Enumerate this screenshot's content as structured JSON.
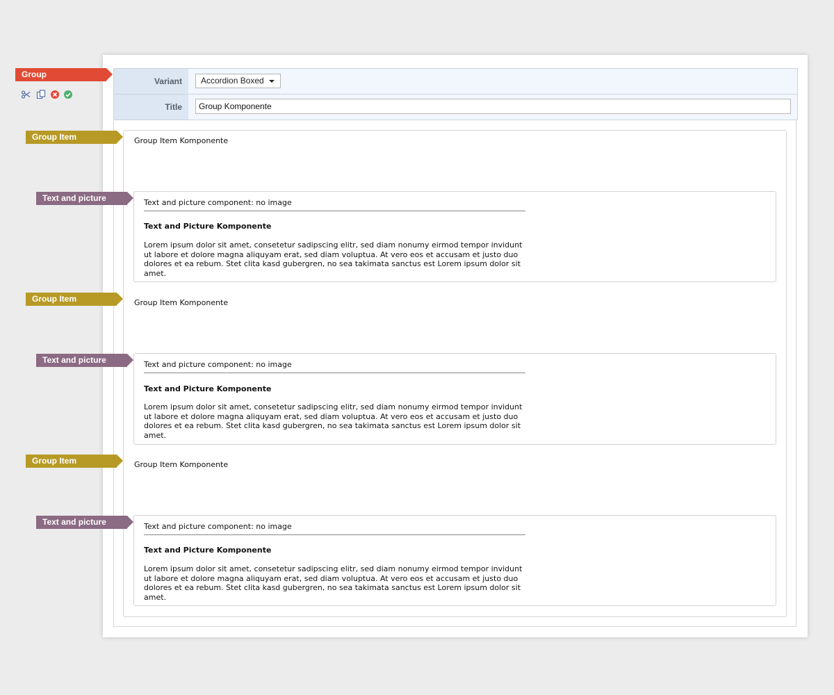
{
  "labels": {
    "group": "Group",
    "group_item": "Group Item",
    "text_and_picture": "Text and picture"
  },
  "toolbar": {
    "icons": [
      "scissors-icon",
      "copy-icon",
      "delete-icon",
      "confirm-icon"
    ],
    "colors": {
      "icon_blue": "#5574a6",
      "delete": "#e5463a",
      "confirm": "#4caf6e"
    }
  },
  "form": {
    "variant": {
      "label": "Variant",
      "value": "Accordion Boxed"
    },
    "title": {
      "label": "Title",
      "value": "Group Komponente"
    }
  },
  "group_items": [
    {
      "title": "Group Item Komponente",
      "text_picture": {
        "header": "Text and picture component: no image",
        "heading": "Text and Picture Komponente",
        "body": "Lorem ipsum dolor sit amet, consetetur sadipscing elitr, sed diam nonumy eirmod tempor invidunt ut labore et dolore magna aliquyam erat, sed diam voluptua. At vero eos et accusam et justo duo dolores et ea rebum. Stet clita kasd gubergren, no sea takimata sanctus est Lorem ipsum dolor sit amet."
      }
    },
    {
      "title": "Group Item Komponente",
      "text_picture": {
        "header": "Text and picture component: no image",
        "heading": "Text and Picture Komponente",
        "body": "Lorem ipsum dolor sit amet, consetetur sadipscing elitr, sed diam nonumy eirmod tempor invidunt ut labore et dolore magna aliquyam erat, sed diam voluptua. At vero eos et accusam et justo duo dolores et ea rebum. Stet clita kasd gubergren, no sea takimata sanctus est Lorem ipsum dolor sit amet."
      }
    },
    {
      "title": "Group Item Komponente",
      "text_picture": {
        "header": "Text and picture component: no image",
        "heading": "Text and Picture Komponente",
        "body": "Lorem ipsum dolor sit amet, consetetur sadipscing elitr, sed diam nonumy eirmod tempor invidunt ut labore et dolore magna aliquyam erat, sed diam voluptua. At vero eos et accusam et justo duo dolores et ea rebum. Stet clita kasd gubergren, no sea takimata sanctus est Lorem ipsum dolor sit amet."
      }
    }
  ],
  "colors": {
    "group_tag": "#e14a34",
    "group_item_tag": "#b79a25",
    "text_picture_tag": "#8b6a83",
    "form_label_bg": "#dde7f4",
    "form_bg": "#f2f7fd"
  }
}
